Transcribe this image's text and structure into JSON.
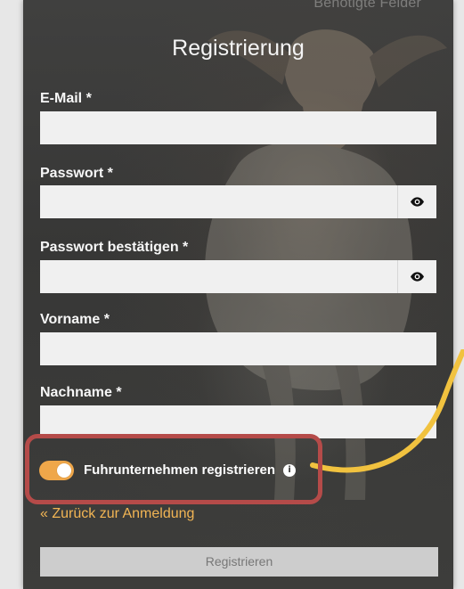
{
  "top_hint": {
    "text": "Benötigte Felder"
  },
  "form": {
    "title": "Registrierung",
    "fields": [
      {
        "label": "E-Mail *",
        "value": "",
        "placeholder": ""
      },
      {
        "label": "Passwort *",
        "value": "",
        "placeholder": "",
        "icon": "eye-icon"
      },
      {
        "label": "Passwort bestätigen *",
        "value": "",
        "placeholder": "",
        "icon": "eye-icon"
      },
      {
        "label": "Vorname *",
        "value": "",
        "placeholder": ""
      },
      {
        "label": "Nachname *",
        "value": "",
        "placeholder": ""
      }
    ],
    "company_toggle": {
      "label": "Fuhrunternehmen registrieren",
      "checked": true,
      "info_icon": "info-icon",
      "info_symbol": "i"
    },
    "back_link": "« Zurück zur Anmeldung",
    "submit_label": "Registrieren"
  },
  "colors": {
    "panel_background": "#383837",
    "accent": "#efa74a",
    "link": "#f2b554",
    "highlight": "#b54b49",
    "input_background": "#f0f0f0",
    "button_background": "#cdcdcd"
  }
}
